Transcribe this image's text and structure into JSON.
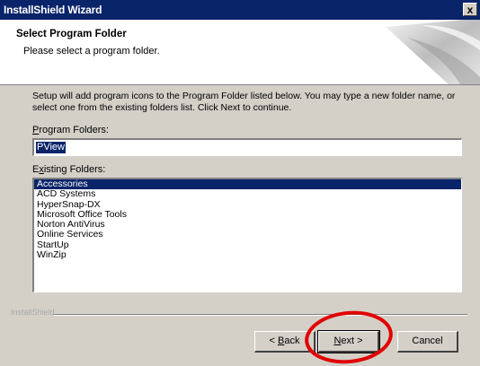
{
  "window": {
    "title": "InstallShield Wizard",
    "close_glyph": "x"
  },
  "header": {
    "title": "Select Program Folder",
    "subtitle": "Please select a program folder."
  },
  "body": {
    "description": "Setup will add program icons to the Program Folder listed below.  You may type a new folder name, or select one from the existing folders list.  Click Next to continue."
  },
  "program_folders": {
    "label_key": "P",
    "label_rest": "rogram Folders:",
    "value": "PView"
  },
  "existing_folders": {
    "label_pre": "E",
    "label_key": "x",
    "label_rest": "isting Folders:",
    "items": [
      "Accessories",
      "ACD Systems",
      "HyperSnap-DX",
      "Microsoft Office Tools",
      "Norton AntiVirus",
      "Online Services",
      "StartUp",
      "WinZip"
    ],
    "selected_index": 0
  },
  "footer": {
    "brand": "InstallShield"
  },
  "buttons": {
    "back_prefix": "< ",
    "back_key": "B",
    "back_rest": "ack",
    "next_key": "N",
    "next_rest": "ext >",
    "cancel": "Cancel"
  },
  "annotation": {
    "circle_color": "#e00000",
    "circled_element": "next-button"
  }
}
